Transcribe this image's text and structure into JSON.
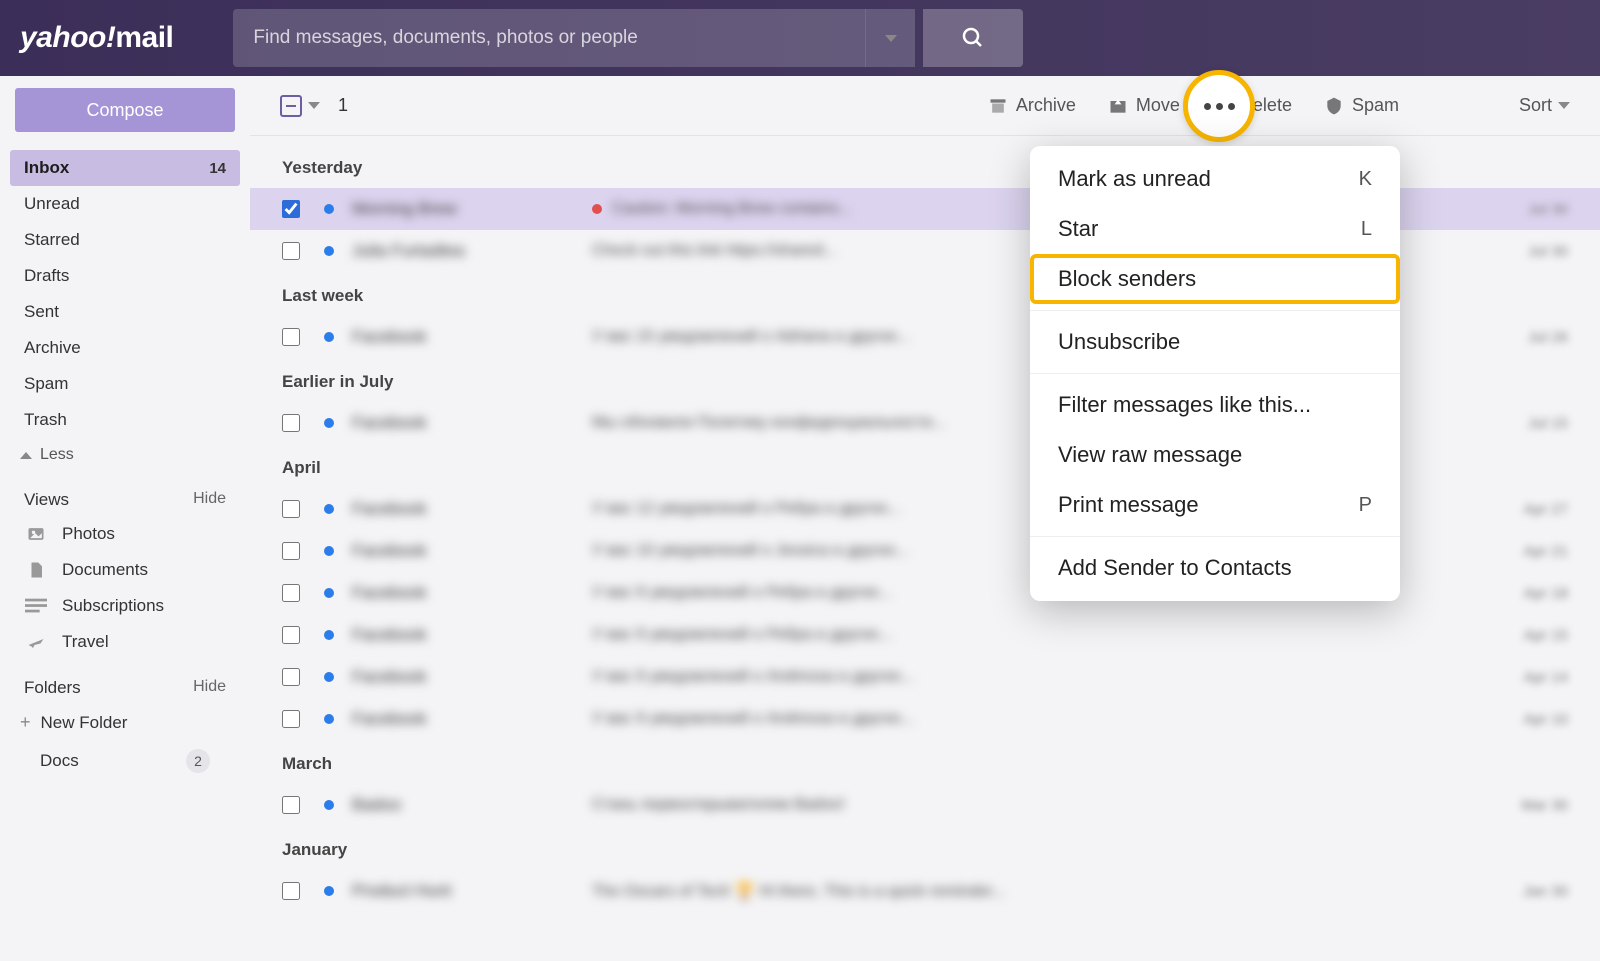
{
  "header": {
    "logo": "yahoo!mail",
    "search_placeholder": "Find messages, documents, photos or people"
  },
  "sidebar": {
    "compose_label": "Compose",
    "folders": [
      {
        "label": "Inbox",
        "badge": "14",
        "active": true
      },
      {
        "label": "Unread"
      },
      {
        "label": "Starred"
      },
      {
        "label": "Drafts"
      },
      {
        "label": "Sent"
      },
      {
        "label": "Archive"
      },
      {
        "label": "Spam"
      },
      {
        "label": "Trash"
      }
    ],
    "less_label": "Less",
    "views_heading": "Views",
    "views_hide": "Hide",
    "views": [
      {
        "label": "Photos",
        "icon": "photo"
      },
      {
        "label": "Documents",
        "icon": "doc"
      },
      {
        "label": "Subscriptions",
        "icon": "subs"
      },
      {
        "label": "Travel",
        "icon": "plane"
      }
    ],
    "folders_heading": "Folders",
    "folders_hide": "Hide",
    "new_folder_label": "New Folder",
    "user_folders": [
      {
        "label": "Docs",
        "count": "2"
      }
    ]
  },
  "toolbar": {
    "selected_count": "1",
    "archive_label": "Archive",
    "move_label": "Move",
    "delete_label": "Delete",
    "spam_label": "Spam",
    "sort_label": "Sort"
  },
  "context_menu": {
    "items": [
      {
        "label": "Mark as unread",
        "shortcut": "K"
      },
      {
        "label": "Star",
        "shortcut": "L"
      },
      {
        "label": "Block senders",
        "highlighted": true
      },
      {
        "divider": true
      },
      {
        "label": "Unsubscribe"
      },
      {
        "divider": true
      },
      {
        "label": "Filter messages like this..."
      },
      {
        "label": "View raw message"
      },
      {
        "label": "Print message",
        "shortcut": "P"
      },
      {
        "divider": true
      },
      {
        "label": "Add Sender to Contacts"
      }
    ]
  },
  "message_groups": [
    {
      "label": "Yesterday",
      "rows": [
        {
          "selected": true,
          "checked": true,
          "unread": true,
          "red": true,
          "sender": "Morning Brew",
          "subject": "Caution: Morning Brew contains...",
          "date": "Jul 30"
        },
        {
          "unread": true,
          "sender": "Julia Furtadtea",
          "subject": "Check out this link  https://shared...",
          "date": "Jul 30"
        }
      ]
    },
    {
      "label": "Last week",
      "rows": [
        {
          "unread": true,
          "sender": "Facebook",
          "subject": "У вас 15 уведомлений о Adriana и других...",
          "date": "Jul 26"
        }
      ]
    },
    {
      "label": "Earlier in July",
      "rows": [
        {
          "unread": true,
          "sender": "Facebook",
          "subject": "Мы обновили Политику конфиденциальности...",
          "date": "Jul 15"
        }
      ]
    },
    {
      "label": "April",
      "rows": [
        {
          "unread": true,
          "sender": "Facebook",
          "subject": "У вас 12 уведомлений о Ребра и других...",
          "date": "Apr 27"
        },
        {
          "unread": true,
          "sender": "Facebook",
          "subject": "У вас 10 уведомлений о Jessica и других...",
          "date": "Apr 21"
        },
        {
          "unread": true,
          "sender": "Facebook",
          "subject": "У вас 9 уведомлений о Ребра и других...",
          "date": "Apr 18"
        },
        {
          "unread": true,
          "sender": "Facebook",
          "subject": "У вас 9 уведомлений о Ребра и других...",
          "date": "Apr 15"
        },
        {
          "unread": true,
          "sender": "Facebook",
          "subject": "У вас 9 уведомлений о Andressa и других...",
          "date": "Apr 14"
        },
        {
          "unread": true,
          "sender": "Facebook",
          "subject": "У вас 9 уведомлений о Andressa и других...",
          "date": "Apr 10"
        }
      ]
    },
    {
      "label": "March",
      "rows": [
        {
          "unread": true,
          "sender": "Badoo",
          "subject": "Стань первооткрывателем Badoo!",
          "date": "Mar 30"
        }
      ]
    },
    {
      "label": "January",
      "rows": [
        {
          "unread": true,
          "sender": "Product Hunt",
          "subject": "The Oscars of Tech 🏆 Hi there, This is a quick reminder...",
          "date": "Jan 30"
        }
      ]
    }
  ]
}
